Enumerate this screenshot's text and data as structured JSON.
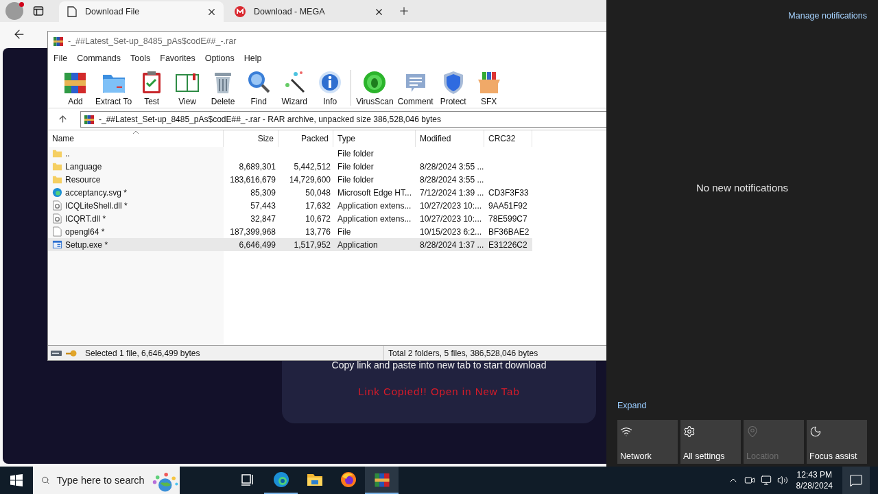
{
  "browser": {
    "tabs": [
      {
        "title": "Download File",
        "selected": true,
        "kind": "page"
      },
      {
        "title": "Download - MEGA",
        "selected": false,
        "kind": "mega"
      }
    ],
    "page": {
      "instruction": "Copy link and paste into new tab to start download",
      "status": "Link Copied!! Open in New Tab"
    }
  },
  "archiver": {
    "title": "-_##Latest_Set-up_8485_pAs$codE##_-.rar",
    "menu": [
      "File",
      "Commands",
      "Tools",
      "Favorites",
      "Options",
      "Help"
    ],
    "toolbar_groups": [
      {
        "items": [
          {
            "label": "Add",
            "kind": "books"
          },
          {
            "label": "Extract To",
            "kind": "folder"
          },
          {
            "label": "Test",
            "kind": "clipboard"
          },
          {
            "label": "View",
            "kind": "book"
          },
          {
            "label": "Delete",
            "kind": "trash"
          },
          {
            "label": "Find",
            "kind": "magnifier"
          },
          {
            "label": "Wizard",
            "kind": "wand"
          },
          {
            "label": "Info",
            "kind": "info"
          }
        ]
      },
      {
        "items": [
          {
            "label": "VirusScan",
            "kind": "bug"
          },
          {
            "label": "Comment",
            "kind": "speech"
          },
          {
            "label": "Protect",
            "kind": "shield"
          },
          {
            "label": "SFX",
            "kind": "box"
          }
        ]
      }
    ],
    "path": "-_##Latest_Set-up_8485_pAs$codE##_-.rar - RAR archive, unpacked size 386,528,046 bytes",
    "columns": [
      {
        "label": "Name",
        "sorted": true
      },
      {
        "label": "Size",
        "sorted": false
      },
      {
        "label": "Packed",
        "sorted": false
      },
      {
        "label": "Type",
        "sorted": false
      },
      {
        "label": "Modified",
        "sorted": false
      },
      {
        "label": "CRC32",
        "sorted": false
      }
    ],
    "rows": [
      {
        "kind": "folder",
        "selected": false,
        "name": "..",
        "type": "File folder"
      },
      {
        "kind": "folder",
        "selected": false,
        "name": "Language",
        "size": "8,689,301",
        "packed": "5,442,512",
        "type": "File folder",
        "modified": "8/28/2024 3:55 ..."
      },
      {
        "kind": "folder",
        "selected": false,
        "name": "Resource",
        "size": "183,616,679",
        "packed": "14,729,600",
        "type": "File folder",
        "modified": "8/28/2024 3:55 ..."
      },
      {
        "kind": "edge",
        "selected": false,
        "name": "acceptancy.svg *",
        "size": "85,309",
        "packed": "50,048",
        "type": "Microsoft Edge HT...",
        "modified": "7/12/2024 1:39 ...",
        "crc": "CD3F3F33"
      },
      {
        "kind": "dll",
        "selected": false,
        "name": "ICQLiteShell.dll *",
        "size": "57,443",
        "packed": "17,632",
        "type": "Application extens...",
        "modified": "10/27/2023 10:...",
        "crc": "9AA51F92"
      },
      {
        "kind": "dll",
        "selected": false,
        "name": "ICQRT.dll *",
        "size": "32,847",
        "packed": "10,672",
        "type": "Application extens...",
        "modified": "10/27/2023 10:...",
        "crc": "78E599C7"
      },
      {
        "kind": "file",
        "selected": false,
        "name": "opengl64 *",
        "size": "187,399,968",
        "packed": "13,776",
        "type": "File",
        "modified": "10/15/2023 6:2...",
        "crc": "BF36BAE2"
      },
      {
        "kind": "exe",
        "selected": true,
        "name": "Setup.exe *",
        "size": "6,646,499",
        "packed": "1,517,952",
        "type": "Application",
        "modified": "8/28/2024 1:37 ...",
        "crc": "E31226C2"
      }
    ],
    "status": {
      "selection": "Selected 1 file, 6,646,499 bytes",
      "total": "Total 2 folders, 5 files, 386,528,046 bytes"
    }
  },
  "notifications": {
    "manage": "Manage notifications",
    "empty": "No new notifications",
    "expand": "Expand",
    "tiles": [
      {
        "label": "Network",
        "kind": "network",
        "disabled": false
      },
      {
        "label": "All settings",
        "kind": "settings",
        "disabled": false
      },
      {
        "label": "Location",
        "kind": "location",
        "disabled": true
      },
      {
        "label": "Focus assist",
        "kind": "moon",
        "disabled": false
      }
    ]
  },
  "taskbar": {
    "placeholder": "Type here to search",
    "apps": [
      {
        "kind": "taskview",
        "running": false,
        "selected": false
      },
      {
        "kind": "edge",
        "running": true,
        "selected": false
      },
      {
        "kind": "explorer",
        "running": false,
        "selected": false
      },
      {
        "kind": "firefox",
        "running": false,
        "selected": false
      },
      {
        "kind": "winrar",
        "running": true,
        "selected": true
      }
    ],
    "time": "12:43 PM",
    "date": "8/28/2024"
  }
}
